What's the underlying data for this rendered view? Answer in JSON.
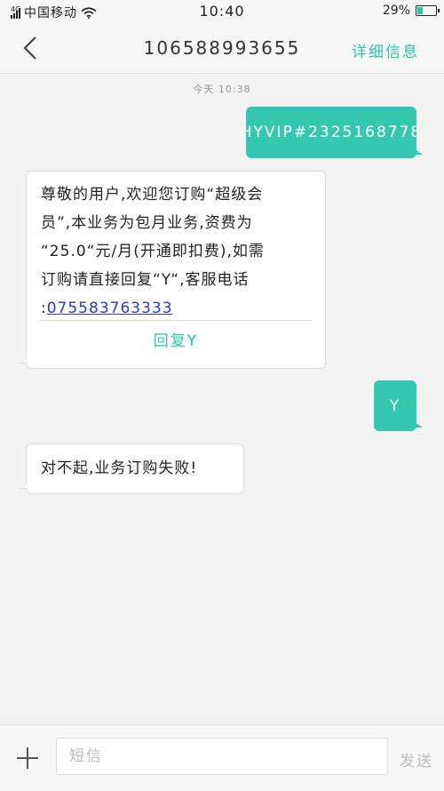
{
  "status_bar": {
    "network": "4G",
    "carrier": "中国移动",
    "time": "10:40",
    "battery_percent": "29%",
    "battery_level": 0.29
  },
  "header": {
    "back_icon": "chevron-left-icon",
    "title": "106588993655",
    "detail_label": "详细信息"
  },
  "conversation": {
    "timestamp": "今天 10:38",
    "messages": [
      {
        "direction": "outgoing",
        "text": "HYVIP#2325168778"
      },
      {
        "direction": "incoming",
        "lines": [
          "尊敬的用户,欢迎您订购“超级会",
          "员”,本业务为包月业务,资费为",
          "“25.0“元/月(开通即扣费),如需",
          "订购请直接回复“Y“,客服电话"
        ],
        "phone_prefix": ":",
        "phone": "075583763333",
        "reply_label": "回复Y"
      },
      {
        "direction": "outgoing",
        "text": "Y"
      },
      {
        "direction": "incoming",
        "text": "对不起,业务订购失败!"
      }
    ]
  },
  "composer": {
    "add_icon": "plus-icon",
    "placeholder": "短信",
    "value": "",
    "send_label": "发送"
  },
  "colors": {
    "accent": "#36c8ae",
    "link": "#2a3cbd"
  }
}
